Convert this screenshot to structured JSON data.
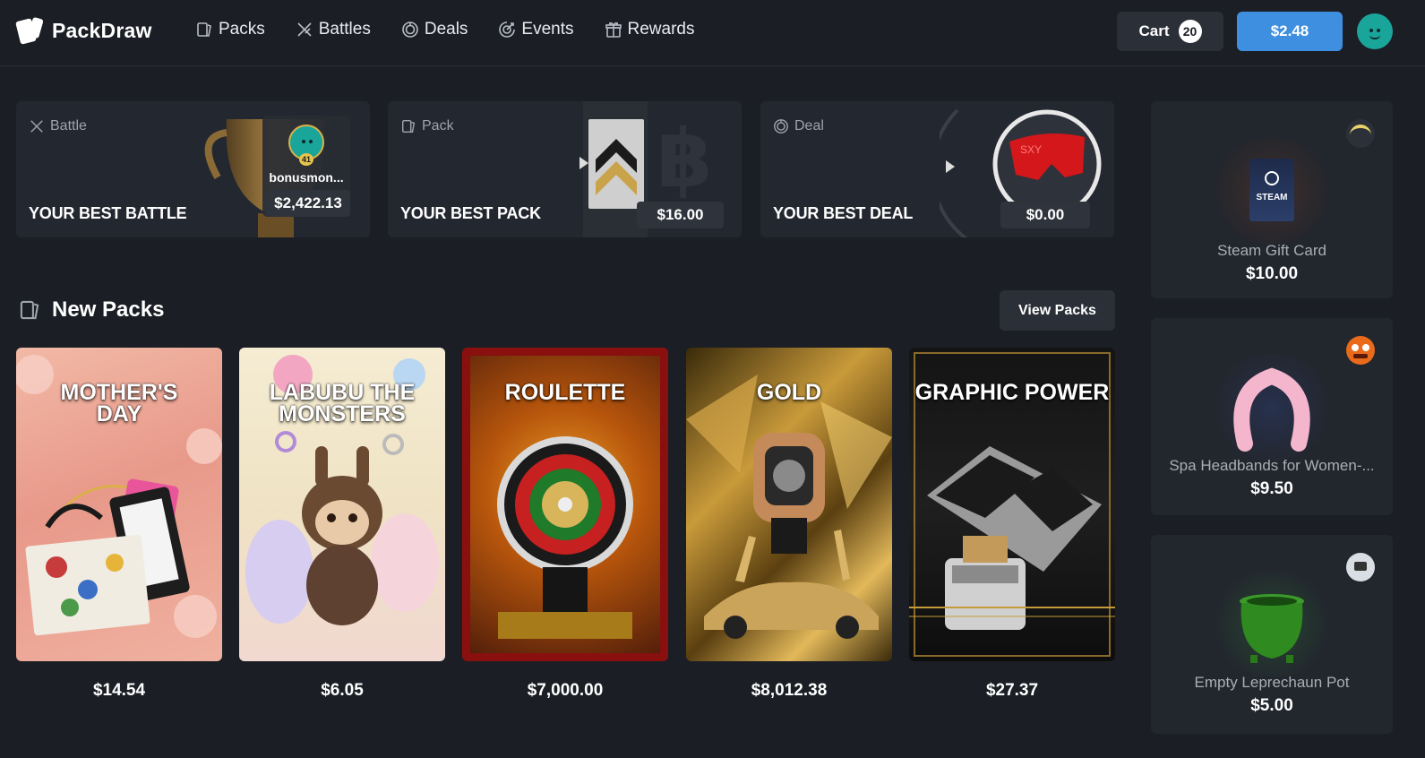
{
  "nav": {
    "brand": "PackDraw",
    "links": [
      {
        "label": "Packs",
        "icon": "cards-icon"
      },
      {
        "label": "Battles",
        "icon": "swords-icon"
      },
      {
        "label": "Deals",
        "icon": "dial-icon"
      },
      {
        "label": "Events",
        "icon": "target-icon"
      },
      {
        "label": "Rewards",
        "icon": "gift-icon"
      }
    ],
    "cart_label": "Cart",
    "cart_count": "20",
    "balance": "$2.48"
  },
  "best": {
    "battle": {
      "tag": "Battle",
      "headline": "YOUR BEST BATTLE",
      "user": "bonusmon...",
      "level": "41",
      "price": "$2,422.13"
    },
    "pack": {
      "tag": "Pack",
      "headline": "YOUR BEST PACK",
      "price": "$16.00"
    },
    "deal": {
      "tag": "Deal",
      "headline": "YOUR BEST DEAL",
      "price": "$0.00",
      "item_text": "SXY"
    }
  },
  "new_packs": {
    "title": "New Packs",
    "view_label": "View Packs",
    "items": [
      {
        "title": "MOTHER'S DAY",
        "price": "$14.54"
      },
      {
        "title": "LABUBU THE MONSTERS",
        "price": "$6.05"
      },
      {
        "title": "ROULETTE",
        "price": "$7,000.00"
      },
      {
        "title": "GOLD",
        "price": "$8,012.38"
      },
      {
        "title": "GRAPHIC POWER",
        "price": "$27.37"
      }
    ]
  },
  "drops": [
    {
      "name": "Steam Gift Card",
      "price": "$10.00",
      "item_label": "STEAM"
    },
    {
      "name": "Spa Headbands for Women-...",
      "price": "$9.50"
    },
    {
      "name": "Empty Leprechaun Pot",
      "price": "$5.00"
    }
  ],
  "colors": {
    "accent": "#3f8fe0",
    "background": "#1b1f25",
    "card": "#23272f"
  }
}
